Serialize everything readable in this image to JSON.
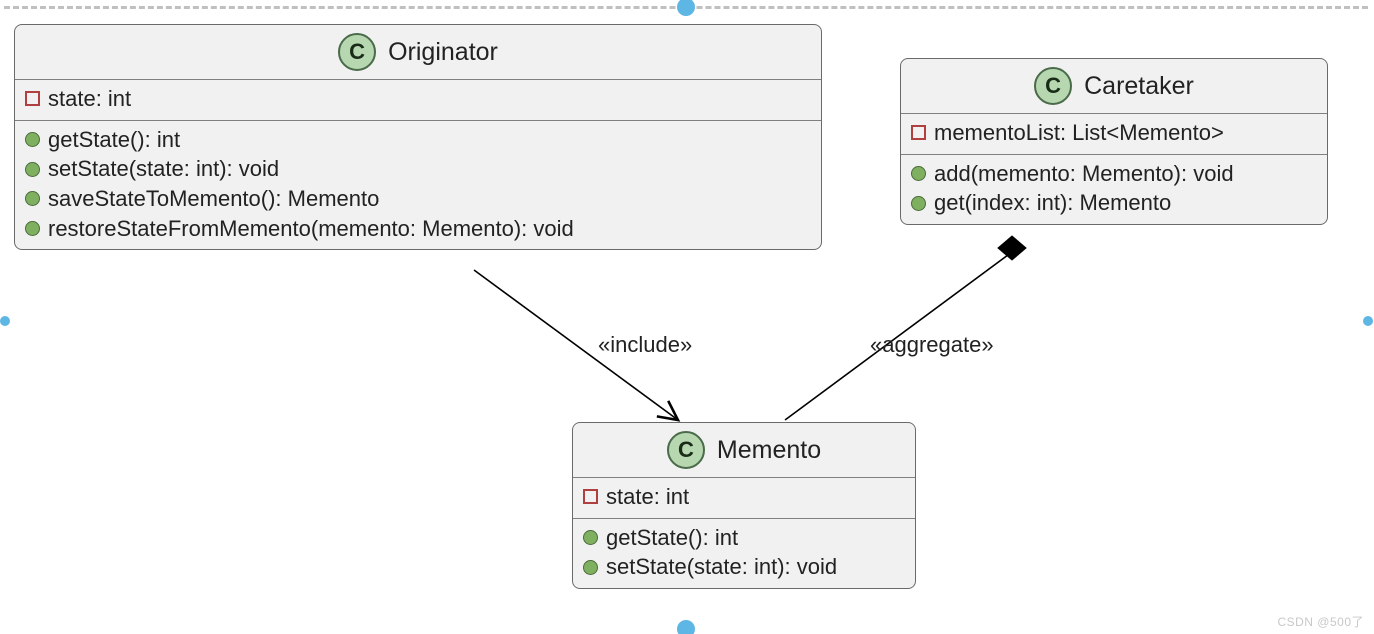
{
  "classes": {
    "originator": {
      "name": "Originator",
      "fields": [
        {
          "vis": "square",
          "text": "state: int"
        }
      ],
      "methods": [
        {
          "vis": "circle",
          "text": "getState(): int"
        },
        {
          "vis": "circle",
          "text": "setState(state: int): void"
        },
        {
          "vis": "circle",
          "text": "saveStateToMemento(): Memento"
        },
        {
          "vis": "circle",
          "text": "restoreStateFromMemento(memento: Memento): void"
        }
      ]
    },
    "caretaker": {
      "name": "Caretaker",
      "fields": [
        {
          "vis": "square",
          "text": "mementoList: List<Memento>"
        }
      ],
      "methods": [
        {
          "vis": "circle",
          "text": "add(memento: Memento): void"
        },
        {
          "vis": "circle",
          "text": "get(index: int): Memento"
        }
      ]
    },
    "memento": {
      "name": "Memento",
      "fields": [
        {
          "vis": "square",
          "text": "state: int"
        }
      ],
      "methods": [
        {
          "vis": "circle",
          "text": "getState(): int"
        },
        {
          "vis": "circle",
          "text": "setState(state: int): void"
        }
      ]
    }
  },
  "connectors": {
    "include_label": "«include»",
    "aggregate_label": "«aggregate»"
  },
  "watermark": "CSDN @500了",
  "chart_data": {
    "type": "uml-class-diagram",
    "classes": [
      {
        "name": "Originator",
        "stereotype": "C",
        "attributes": [
          {
            "visibility": "private",
            "name": "state",
            "type": "int"
          }
        ],
        "operations": [
          {
            "visibility": "public",
            "name": "getState",
            "params": [],
            "return": "int"
          },
          {
            "visibility": "public",
            "name": "setState",
            "params": [
              {
                "name": "state",
                "type": "int"
              }
            ],
            "return": "void"
          },
          {
            "visibility": "public",
            "name": "saveStateToMemento",
            "params": [],
            "return": "Memento"
          },
          {
            "visibility": "public",
            "name": "restoreStateFromMemento",
            "params": [
              {
                "name": "memento",
                "type": "Memento"
              }
            ],
            "return": "void"
          }
        ]
      },
      {
        "name": "Caretaker",
        "stereotype": "C",
        "attributes": [
          {
            "visibility": "private",
            "name": "mementoList",
            "type": "List<Memento>"
          }
        ],
        "operations": [
          {
            "visibility": "public",
            "name": "add",
            "params": [
              {
                "name": "memento",
                "type": "Memento"
              }
            ],
            "return": "void"
          },
          {
            "visibility": "public",
            "name": "get",
            "params": [
              {
                "name": "index",
                "type": "int"
              }
            ],
            "return": "Memento"
          }
        ]
      },
      {
        "name": "Memento",
        "stereotype": "C",
        "attributes": [
          {
            "visibility": "private",
            "name": "state",
            "type": "int"
          }
        ],
        "operations": [
          {
            "visibility": "public",
            "name": "getState",
            "params": [],
            "return": "int"
          },
          {
            "visibility": "public",
            "name": "setState",
            "params": [
              {
                "name": "state",
                "type": "int"
              }
            ],
            "return": "void"
          }
        ]
      }
    ],
    "relationships": [
      {
        "from": "Originator",
        "to": "Memento",
        "type": "dependency",
        "label": "«include»",
        "arrow": "open"
      },
      {
        "from": "Caretaker",
        "to": "Memento",
        "type": "aggregation",
        "label": "«aggregate»",
        "diamond_at": "Caretaker"
      }
    ]
  }
}
